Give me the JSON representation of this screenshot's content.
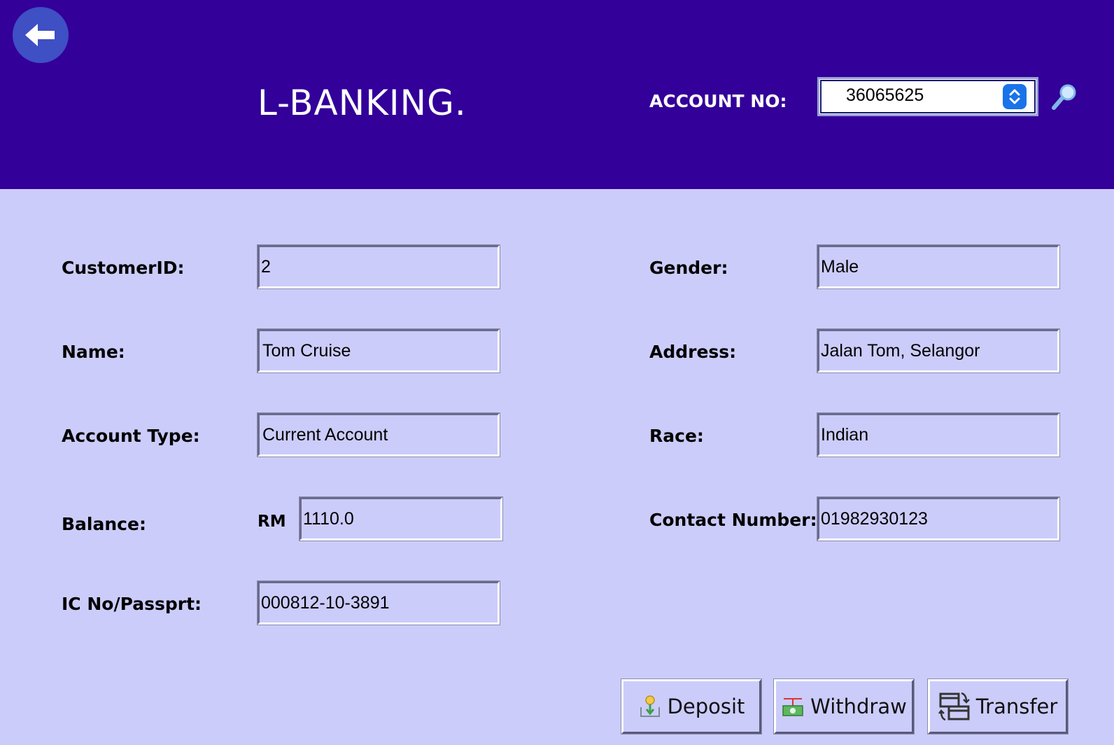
{
  "header": {
    "title": "L-BANKING.",
    "account_label": "ACCOUNT NO:",
    "account_selected": "36065625"
  },
  "form": {
    "customer_id": {
      "label": "CustomerID:",
      "value": "2"
    },
    "name": {
      "label": "Name:",
      "value": "Tom Cruise"
    },
    "account_type": {
      "label": "Account Type:",
      "value": "Current Account"
    },
    "balance": {
      "label": "Balance:",
      "currency": "RM",
      "value": "1110.0"
    },
    "ic_no": {
      "label": "IC No/Passprt:",
      "value": "000812-10-3891"
    },
    "gender": {
      "label": "Gender:",
      "value": "Male"
    },
    "address": {
      "label": "Address:",
      "value": "Jalan Tom, Selangor"
    },
    "race": {
      "label": "Race:",
      "value": "Indian"
    },
    "contact": {
      "label": "Contact Number:",
      "value": "01982930123"
    }
  },
  "actions": {
    "deposit": "Deposit",
    "withdraw": "Withdraw",
    "transfer": "Transfer"
  },
  "icons": {
    "back": "arrow-left-icon",
    "search": "search-icon",
    "stepper": "chevron-up-down-icon",
    "deposit": "coin-deposit-icon",
    "withdraw": "cash-withdraw-icon",
    "transfer": "transfer-icon"
  },
  "colors": {
    "header_bg": "#330099",
    "body_bg": "#ccccfb",
    "back_button": "#3f4fc4",
    "stepper": "#1a73e8"
  }
}
